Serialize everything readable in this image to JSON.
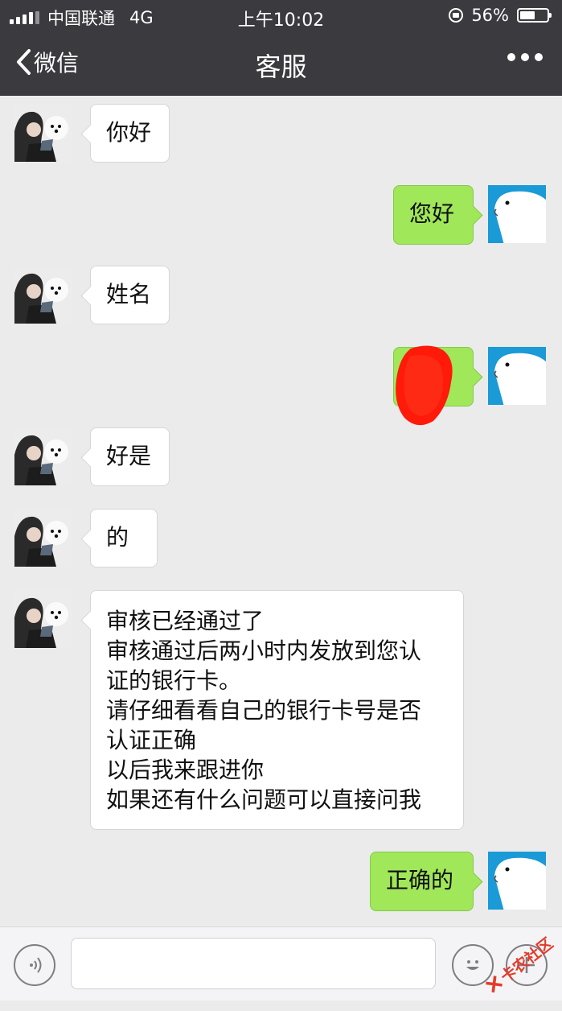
{
  "status_bar": {
    "carrier": "中国联通",
    "network": "4G",
    "time": "上午10:02",
    "battery": "56%",
    "battery_level": 0.56
  },
  "nav": {
    "back_label": "微信",
    "title": "客服"
  },
  "messages": [
    {
      "from": "them",
      "lines": [
        "你好"
      ]
    },
    {
      "from": "me",
      "lines": [
        "您好"
      ]
    },
    {
      "from": "them",
      "lines": [
        "姓名"
      ]
    },
    {
      "from": "me",
      "lines": [],
      "redacted": true
    },
    {
      "from": "them",
      "lines": [
        "好是"
      ]
    },
    {
      "from": "them",
      "lines": [
        "的"
      ]
    },
    {
      "from": "them",
      "lines": [
        "审核已经通过了",
        "审核通过后两小时内发放到您认",
        "证的银行卡。",
        "请仔细看看自己的银行卡号是否",
        "认证正确",
        "以后我来跟进你",
        "如果还有什么问题可以直接问我"
      ]
    },
    {
      "from": "me",
      "lines": [
        "正确的"
      ]
    }
  ],
  "input_bar": {
    "voice_icon": "voice-icon",
    "emoji_icon": "emoji-icon",
    "plus_icon": "plus-icon"
  },
  "watermark": {
    "text": "卡农社区"
  },
  "colors": {
    "header_bg": "#3a3a3f",
    "chat_bg": "#ebebeb",
    "my_bubble": "#a0e75a",
    "their_bubble": "#ffffff",
    "redaction": "#ff1a0a",
    "my_avatar": "#1a9ad6"
  }
}
